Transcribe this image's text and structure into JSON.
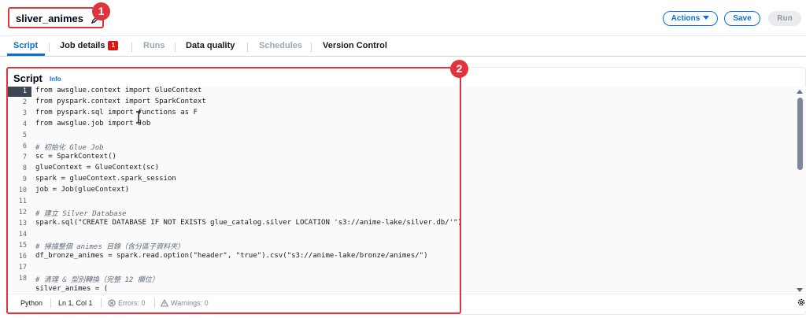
{
  "header": {
    "job_name": "sliver_animes",
    "actions_label": "Actions",
    "save_label": "Save",
    "run_label": "Run",
    "annotation_1": "1",
    "annotation_2": "2"
  },
  "tabs": [
    {
      "label": "Script",
      "state": "active"
    },
    {
      "label": "Job details",
      "state": "normal",
      "count": "1"
    },
    {
      "label": "Runs",
      "state": "disabled"
    },
    {
      "label": "Data quality",
      "state": "normal"
    },
    {
      "label": "Schedules",
      "state": "disabled"
    },
    {
      "label": "Version Control",
      "state": "normal"
    }
  ],
  "panel": {
    "title": "Script",
    "info_link": "Info"
  },
  "editor": {
    "line_numbers": [
      "1",
      "2",
      "3",
      "4",
      "5",
      "6",
      "7",
      "8",
      "9",
      "10",
      "11",
      "12",
      "13",
      "14",
      "15",
      "16",
      "17",
      "18"
    ],
    "lines": [
      "from awsglue.context import GlueContext",
      "from pyspark.context import SparkContext",
      "from pyspark.sql import functions as F",
      "from awsglue.job import Job",
      "",
      "# 初始化 Glue Job",
      "sc = SparkContext()",
      "glueContext = GlueContext(sc)",
      "spark = glueContext.spark_session",
      "job = Job(glueContext)",
      "",
      "# 建立 Silver Database",
      "spark.sql(\"CREATE DATABASE IF NOT EXISTS glue_catalog.silver LOCATION 's3://anime-lake/silver.db/'\")",
      "",
      "# 掃描整個 animes 目錄（含分區子資料夾）",
      "df_bronze_animes = spark.read.option(\"header\", \"true\").csv(\"s3://anime-lake/bronze/animes/\")",
      "",
      "# 清理 & 型別轉換（完整 12 欄位）"
    ],
    "partial_line": "silver_animes = ("
  },
  "statusbar": {
    "language": "Python",
    "position": "Ln 1, Col 1",
    "errors": "Errors: 0",
    "warnings": "Warnings: 0"
  },
  "colors": {
    "accent": "#0972d3",
    "annotation_red": "#e0333b",
    "error_badge": "#d91515"
  }
}
